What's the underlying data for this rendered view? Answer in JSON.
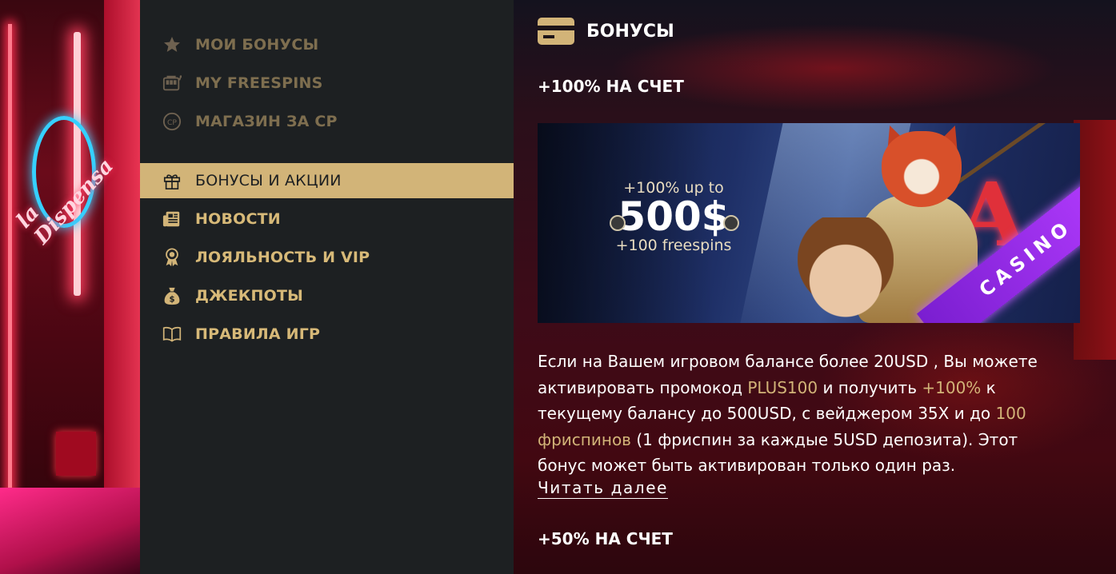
{
  "menu": {
    "items": [
      {
        "label": "МОИ БОНУСЫ",
        "icon": "star-icon"
      },
      {
        "label": "MY FREESPINS",
        "icon": "slot-machine-icon"
      },
      {
        "label": "МАГАЗИН ЗА CP",
        "icon": "cp-coin-icon"
      },
      {
        "label": "БОНУСЫ И АКЦИИ",
        "icon": "gift-icon"
      },
      {
        "label": "НОВОСТИ",
        "icon": "newspaper-icon"
      },
      {
        "label": "ЛОЯЛЬНОСТЬ И VIP",
        "icon": "medal-icon"
      },
      {
        "label": "ДЖЕКПОТЫ",
        "icon": "money-bag-icon"
      },
      {
        "label": "ПРАВИЛА ИГР",
        "icon": "book-icon"
      }
    ],
    "cp_icon_text": "CP",
    "active_index": 3
  },
  "content": {
    "title": "БОНУСЫ",
    "title_icon": "card-icon",
    "bonuses": [
      {
        "heading": "+100% НА СЧЕТ"
      },
      {
        "heading": "+50% НА СЧЕТ"
      }
    ],
    "banner": {
      "line1": "+100% up to",
      "amount": "500$",
      "line3": "+100 freespins",
      "ribbon": "CASINO"
    },
    "description": {
      "p1": "Если на Вашем игровом балансе более 20USD , Вы можете активировать промокод ",
      "code": "PLUS100",
      "p2": " и получить ",
      "percent": "+100%",
      "p3": " к текущему балансу до 500USD, с вейджером 35X и до ",
      "freespins": "100 фриспинов",
      "p4": " (1 фриспин за каждые 5USD депозита). Этот бонус может быть активирован только один раз."
    },
    "read_more": "Читать далее"
  },
  "colors": {
    "accent_gold": "#d2b478",
    "sidebar_bg": "#1d2022",
    "muted_gold": "#7e6e4f"
  }
}
